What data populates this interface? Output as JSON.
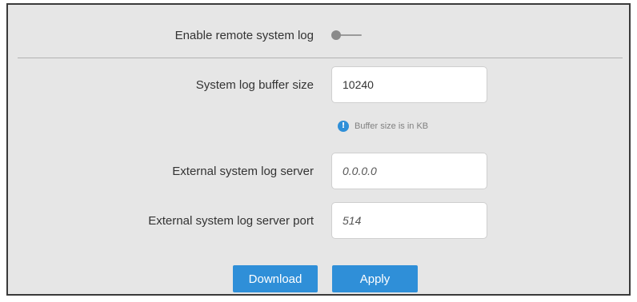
{
  "remote_log": {
    "label": "Enable remote system log",
    "enabled": false
  },
  "buffer_size": {
    "label": "System log buffer size",
    "value": "10240",
    "hint": "Buffer size is in KB",
    "hint_icon": "info-icon"
  },
  "log_server": {
    "label": "External system log server",
    "placeholder": "0.0.0.0",
    "value": ""
  },
  "log_server_port": {
    "label": "External system log server port",
    "placeholder": "514",
    "value": ""
  },
  "actions": {
    "download_label": "Download",
    "apply_label": "Apply"
  },
  "colors": {
    "panel_background": "#e6e6e6",
    "accent": "#2f8fd8",
    "toggle_off": "#8a8a8a"
  }
}
